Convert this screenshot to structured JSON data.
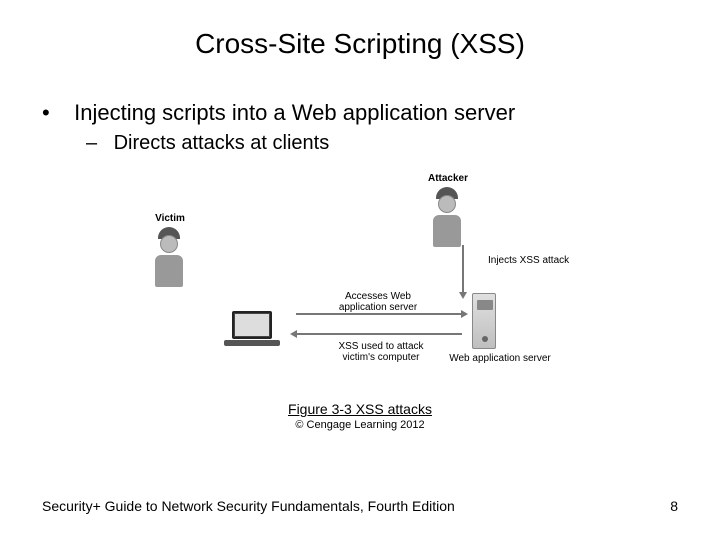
{
  "title": "Cross-Site Scripting (XSS)",
  "bullets": {
    "lvl1": "Injecting scripts into a Web application server",
    "lvl2": "Directs attacks at clients"
  },
  "diagram": {
    "attacker": "Attacker",
    "victim": "Victim",
    "injects": "Injects XSS attack",
    "accesses": "Accesses Web\napplication server",
    "used": "XSS used to attack\nvictim's computer",
    "server": "Web application server"
  },
  "figure": {
    "caption": "Figure 3-3 XSS attacks",
    "credit": "© Cengage Learning 2012"
  },
  "footer": {
    "book": "Security+ Guide to Network Security Fundamentals, Fourth Edition",
    "page": "8"
  }
}
